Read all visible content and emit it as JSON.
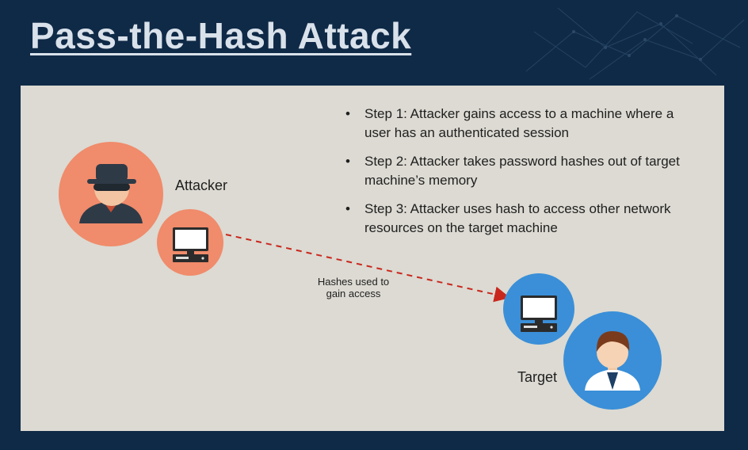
{
  "slide": {
    "title": "Pass-the-Hash Attack",
    "steps": [
      "Step 1: Attacker gains access to a machine where a user has an authenticated session",
      "Step 2: Attacker takes password hashes out of target machine’s memory",
      "Step 3: Attacker uses hash to access other network resources on the target machine"
    ]
  },
  "diagram": {
    "attacker_label": "Attacker",
    "target_label": "Target",
    "arrow_label": "Hashes used to\ngain access"
  },
  "colors": {
    "background": "#0f2a47",
    "panel": "#dcdad2",
    "attacker_circle": "#f08b6b",
    "target_circle": "#3a8fd8",
    "arrow": "#c9271e"
  },
  "icons": {
    "attacker": "hacker-icon",
    "attacker_machine": "computer-icon",
    "target_machine": "computer-icon",
    "target": "businessman-icon"
  }
}
